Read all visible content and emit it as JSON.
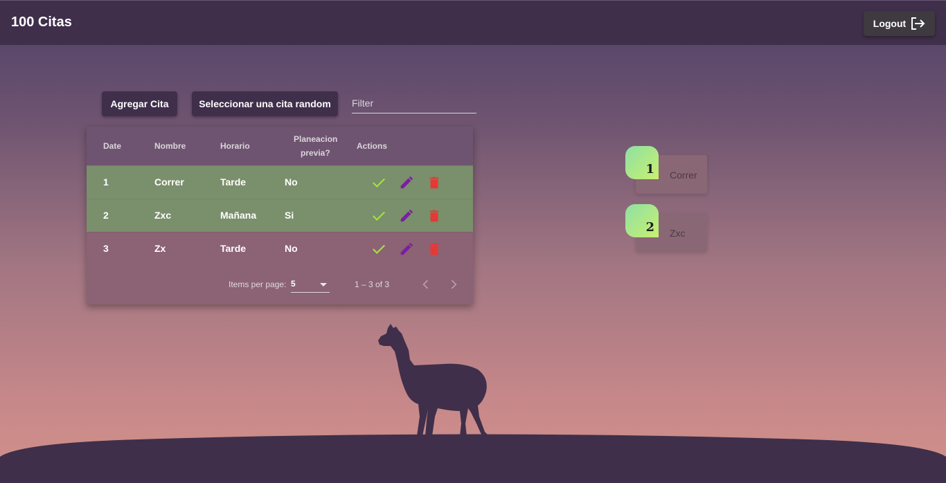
{
  "header": {
    "title": "100 Citas",
    "logout_label": "Logout"
  },
  "toolbar": {
    "add_label": "Agregar Cita",
    "random_label": "Seleccionar una cita random",
    "filter_placeholder": "Filter",
    "filter_value": ""
  },
  "table": {
    "columns": {
      "date": "Date",
      "nombre": "Nombre",
      "horario": "Horario",
      "planeacion_1": "Planeacion",
      "planeacion_2": "previa?",
      "actions": "Actions"
    },
    "rows": [
      {
        "date": "1",
        "nombre": "Correr",
        "horario": "Tarde",
        "planeacion": "No",
        "completed": true
      },
      {
        "date": "2",
        "nombre": "Zxc",
        "horario": "Mañana",
        "planeacion": "Si",
        "completed": true
      },
      {
        "date": "3",
        "nombre": "Zx",
        "horario": "Tarde",
        "planeacion": "No",
        "completed": false
      }
    ],
    "paginator": {
      "items_per_page_label": "Items per page:",
      "items_per_page": "5",
      "range": "1 – 3 of 3"
    }
  },
  "cards": [
    {
      "number": "1",
      "label": "Correr"
    },
    {
      "number": "2",
      "label": "Zxc"
    }
  ],
  "colors": {
    "header": "#3f2f4a",
    "completed_row": "#7a8f6b",
    "check": "#a6e13e",
    "edit": "#7b1fa2",
    "delete": "#e53935"
  },
  "icons": {
    "logout": "logout-icon",
    "complete": "check-icon",
    "edit": "pencil-icon",
    "delete": "trash-icon",
    "prev": "chevron-left-icon",
    "next": "chevron-right-icon"
  }
}
